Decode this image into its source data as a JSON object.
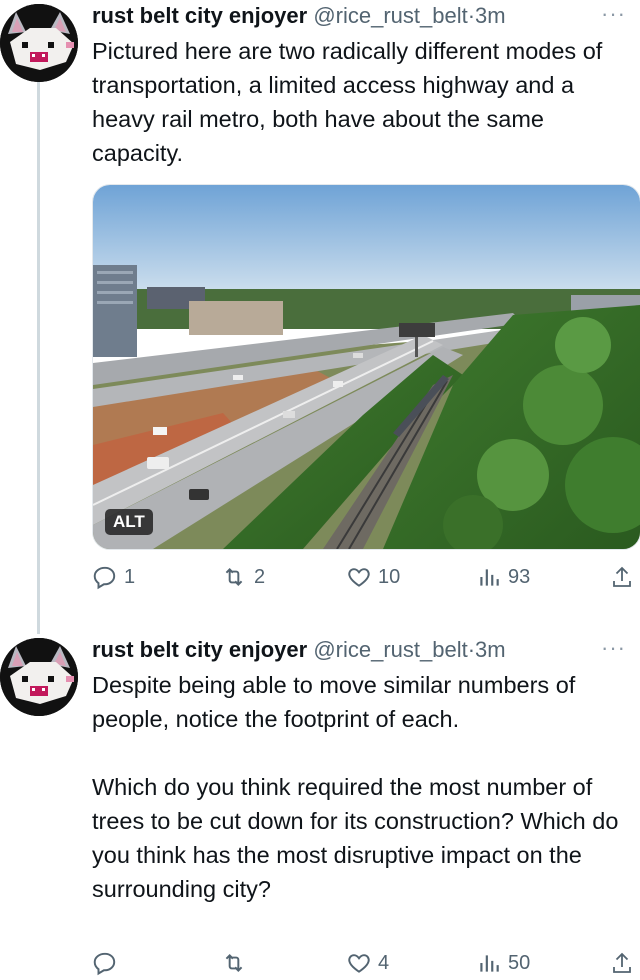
{
  "tweets": [
    {
      "author": {
        "name": "rust belt city enjoyer",
        "handle": "@rice_rust_belt",
        "separator": "·",
        "time": "3m"
      },
      "more_icon": "more-horizontal-icon",
      "text": "Pictured here are two radically different modes of transportation, a limited access highway and a heavy rail metro, both have about the same capacity.",
      "media": {
        "alt_badge": "ALT"
      },
      "actions": {
        "replies": "1",
        "retweets": "2",
        "likes": "10",
        "views": "93"
      }
    },
    {
      "author": {
        "name": "rust belt city enjoyer",
        "handle": "@rice_rust_belt",
        "separator": "·",
        "time": "3m"
      },
      "more_icon": "more-horizontal-icon",
      "text": "Despite being able to move similar numbers of people, notice the footprint of each.\n\nWhich do you think required the most number of trees to be cut down for its construction? Which do you think has the most disruptive impact on the surrounding city?",
      "actions": {
        "replies": "",
        "retweets": "",
        "likes": "4",
        "views": "50"
      }
    }
  ],
  "colors": {
    "text": "#0f1419",
    "secondary": "#536471",
    "thread_line": "#cfd9de"
  }
}
